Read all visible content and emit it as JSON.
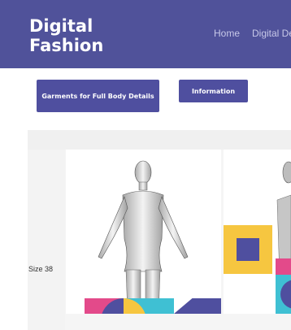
{
  "header": {
    "brand_line1": "Digital",
    "brand_line2": "Fashion",
    "nav": [
      {
        "label": "Home"
      },
      {
        "label": "Digital De"
      }
    ]
  },
  "buttons": {
    "garments_label": "Garments for Full Body Details",
    "information_label": "Information"
  },
  "table": {
    "row_label": "Size 38"
  },
  "colors": {
    "header_bg": "#50529a",
    "button_bg": "#4f4f9f",
    "pink": "#e34a8a",
    "yellow": "#f6c640",
    "teal": "#3fc0d3",
    "navy": "#4f4f9f"
  }
}
